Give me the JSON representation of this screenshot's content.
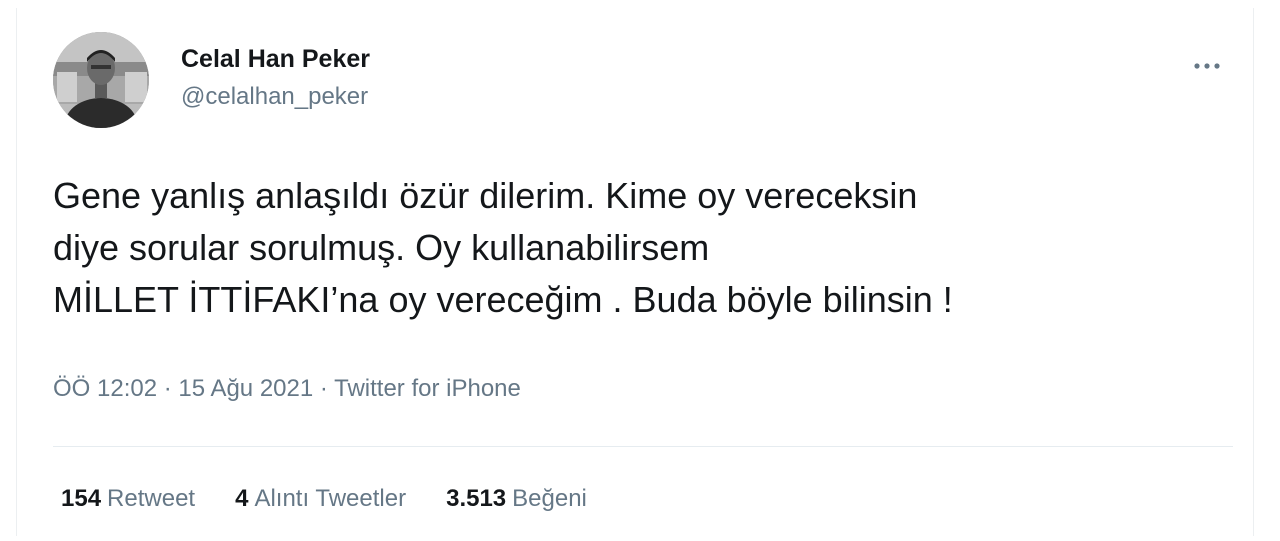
{
  "author": {
    "display_name": "Celal Han Peker",
    "handle": "@celalhan_peker"
  },
  "more_icon": "more-horizontal-icon",
  "tweet": {
    "lines": [
      "Gene yanlış anlaşıldı özür dilerim. Kime oy vereceksin",
      "diye sorular sorulmuş. Oy kullanabilirsem",
      "MİLLET İTTİFAKI’na oy vereceğim . Buda böyle bilinsin !"
    ]
  },
  "meta": {
    "time": "ÖÖ 12:02",
    "separator": "·",
    "date": "15 Ağu 2021",
    "source": "Twitter for iPhone"
  },
  "stats": {
    "retweets": {
      "count": "154",
      "label": "Retweet"
    },
    "quotes": {
      "count": "4",
      "label": "Alıntı Tweetler"
    },
    "likes": {
      "count": "3.513",
      "label": "Beğeni"
    }
  },
  "colors": {
    "text_primary": "#14171a",
    "text_secondary": "#657786",
    "divider": "#e6ecf0"
  }
}
